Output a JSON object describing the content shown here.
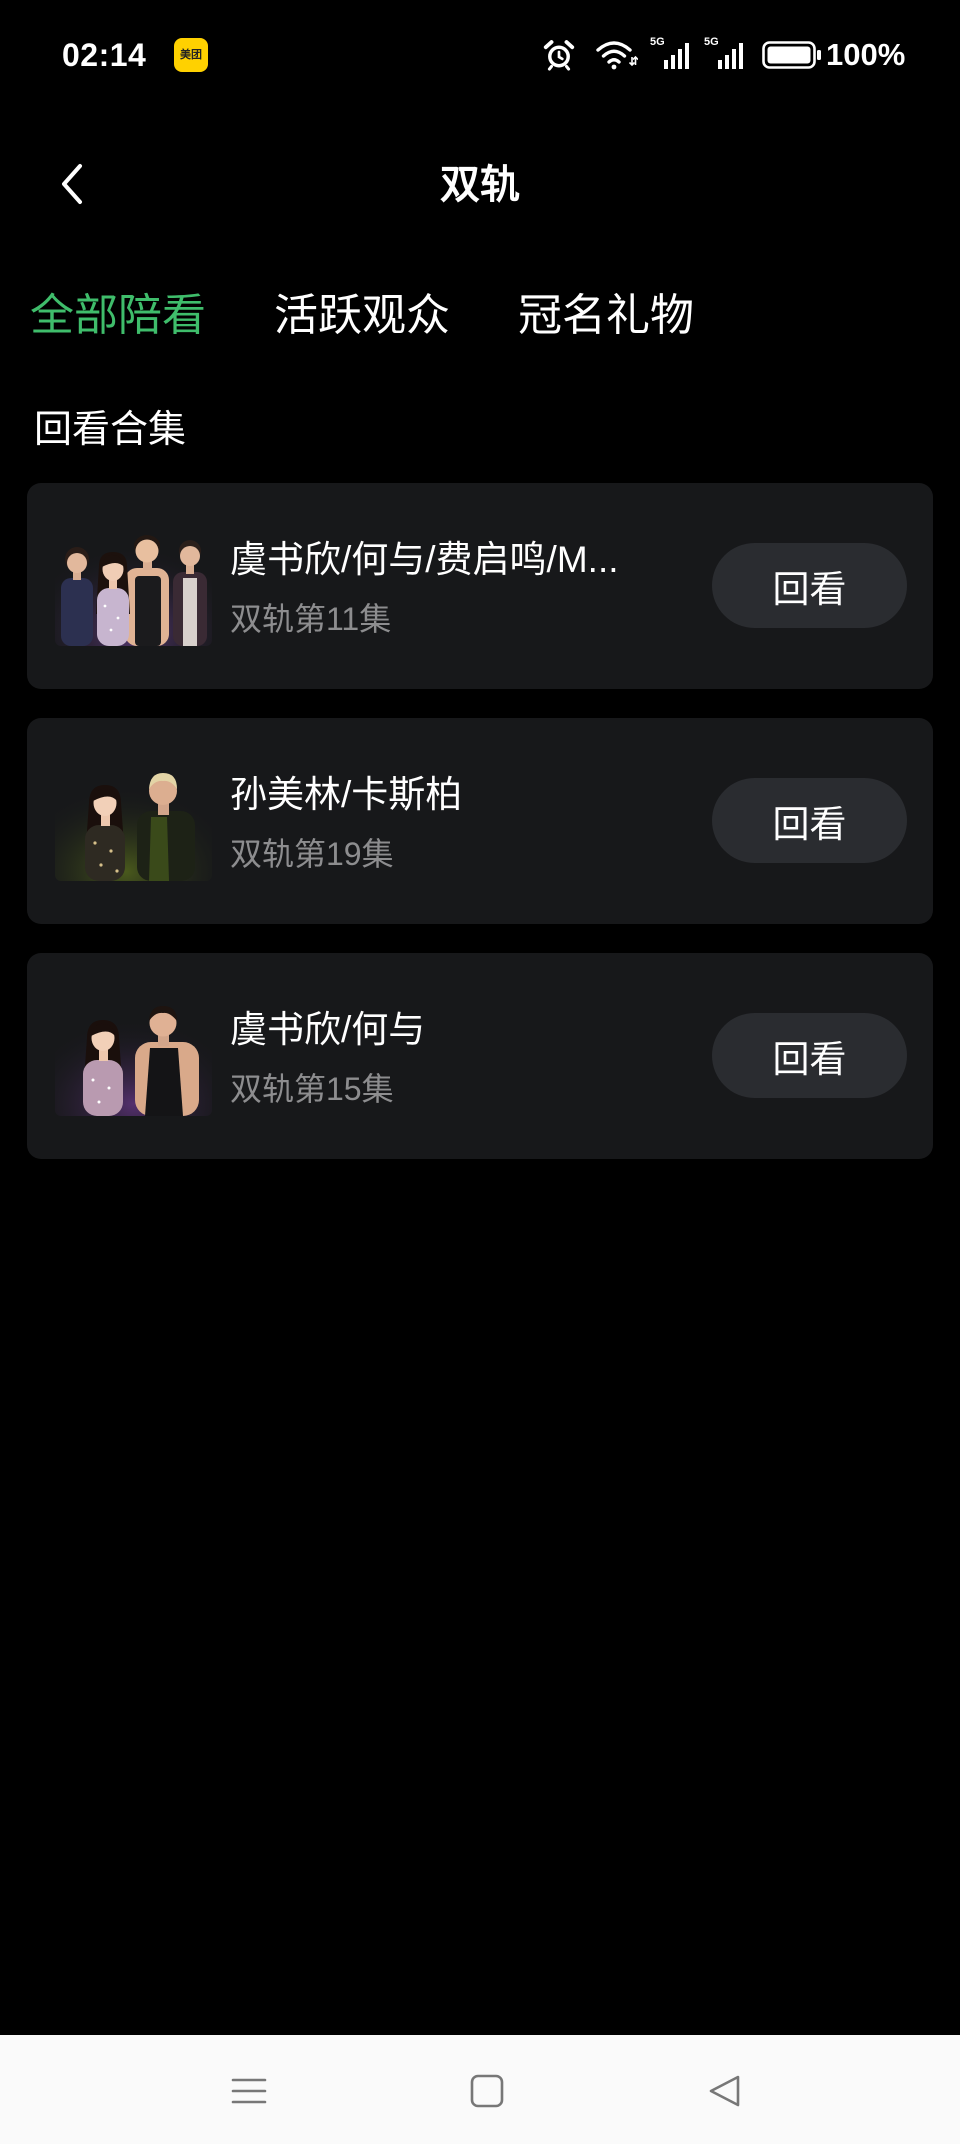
{
  "status_bar": {
    "time": "02:14",
    "app_icon": "meituan-app-icon",
    "app_icon_text": "美团",
    "alarm_icon": "alarm-icon",
    "wifi_icon": "wifi-icon",
    "signal_1": {
      "icon": "signal-icon",
      "label": "5G"
    },
    "signal_2": {
      "icon": "signal-icon",
      "label": "5G"
    },
    "battery_icon": "battery-icon",
    "battery_level": "100%"
  },
  "header": {
    "back_icon": "chevron-left-icon",
    "title": "双轨"
  },
  "tabs": [
    {
      "label": "全部陪看",
      "active": true
    },
    {
      "label": "活跃观众",
      "active": false
    },
    {
      "label": "冠名礼物",
      "active": false
    }
  ],
  "section": {
    "title": "回看合集"
  },
  "episodes": [
    {
      "title": "虞书欣/何与/费启鸣/M...",
      "subtitle": "双轨第11集",
      "button_label": "回看"
    },
    {
      "title": "孙美林/卡斯柏",
      "subtitle": "双轨第19集",
      "button_label": "回看"
    },
    {
      "title": "虞书欣/何与",
      "subtitle": "双轨第15集",
      "button_label": "回看"
    }
  ],
  "nav_bar": {
    "menu_icon": "menu-icon",
    "home_icon": "square-home-icon",
    "back_icon": "triangle-back-icon"
  },
  "colors": {
    "accent": "#3fbd6b",
    "background": "#000000",
    "card": "#17181a",
    "button": "#2a2c30",
    "subtitle": "#8d8d8f",
    "nav_bar": "#fafafa"
  }
}
